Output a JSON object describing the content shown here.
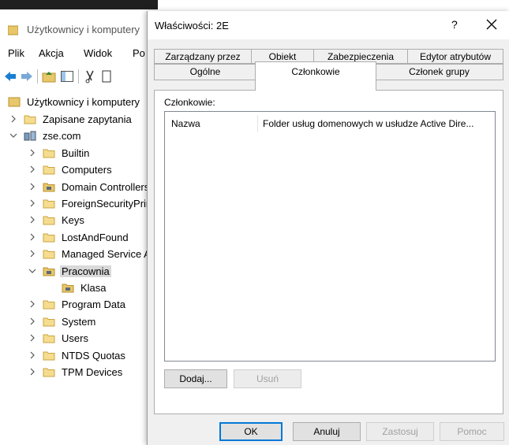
{
  "background_window": {
    "title": "Użytkownicy i komputery",
    "menu": [
      "Plik",
      "Akcja",
      "Widok",
      "Po"
    ],
    "tree_root": "Użytkownicy i komputery",
    "tree": [
      {
        "label": "Zapisane zapytania",
        "expanded": false
      },
      {
        "label": "zse.com",
        "expanded": true
      },
      {
        "label": "Builtin",
        "expanded": false
      },
      {
        "label": "Computers",
        "expanded": false
      },
      {
        "label": "Domain Controllers",
        "expanded": false
      },
      {
        "label": "ForeignSecurityPrincipals",
        "expanded": false
      },
      {
        "label": "Keys",
        "expanded": false
      },
      {
        "label": "LostAndFound",
        "expanded": false
      },
      {
        "label": "Managed Service Accounts",
        "expanded": false
      },
      {
        "label": "Pracownia",
        "expanded": true,
        "selected": true
      },
      {
        "label": "Klasa",
        "expanded": false
      },
      {
        "label": "Program Data",
        "expanded": false
      },
      {
        "label": "System",
        "expanded": false
      },
      {
        "label": "Users",
        "expanded": false
      },
      {
        "label": "NTDS Quotas",
        "expanded": false
      },
      {
        "label": "TPM Devices",
        "expanded": false
      }
    ]
  },
  "dialog": {
    "title": "Właściwości: 2E",
    "help": "?",
    "tabs_row1": [
      "Zarządzany przez",
      "Obiekt",
      "Zabezpieczenia",
      "Edytor atrybutów"
    ],
    "tabs_row2": [
      "Ogólne",
      "Członkowie",
      "Członek grupy"
    ],
    "active_tab": "Członkowie",
    "members_label": "Członkowie:",
    "columns": [
      "Nazwa",
      "Folder usług domenowych w usłudze Active Dire..."
    ],
    "rows": [],
    "buttons": {
      "add": "Dodaj...",
      "remove": "Usuń",
      "ok": "OK",
      "cancel": "Anuluj",
      "apply": "Zastosuj",
      "help": "Pomoc"
    }
  },
  "colors": {
    "dialog_bg": "#f0f0f0",
    "focus_border": "#0078d7",
    "folder": "#e8c76a"
  }
}
